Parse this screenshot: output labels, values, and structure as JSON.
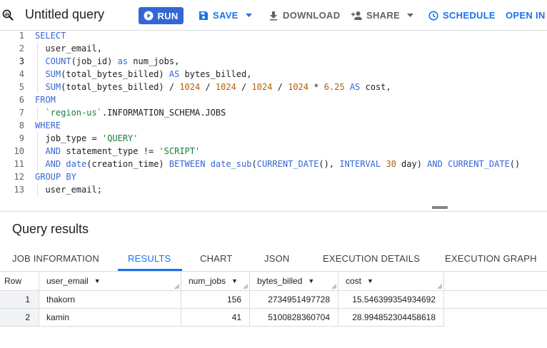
{
  "toolbar": {
    "title": "Untitled query",
    "run_label": "RUN",
    "save_label": "SAVE",
    "download_label": "DOWNLOAD",
    "share_label": "SHARE",
    "schedule_label": "SCHEDULE",
    "open_in_label": "OPEN IN",
    "icons": {
      "query": "query-magnifier-icon",
      "run": "play-circle-icon",
      "save": "save-disk-icon",
      "download": "download-icon",
      "share": "person-add-icon",
      "schedule": "clock-icon"
    }
  },
  "editor": {
    "active_line": 3,
    "lines": [
      {
        "num": "1",
        "tokens": [
          {
            "t": "SELECT",
            "c": "kw"
          }
        ]
      },
      {
        "num": "2",
        "tokens": [
          {
            "t": "  user_email,",
            "c": "plain"
          }
        ]
      },
      {
        "num": "3",
        "tokens": [
          {
            "t": "  ",
            "c": "plain"
          },
          {
            "t": "COUNT",
            "c": "kw"
          },
          {
            "t": "(job_id) ",
            "c": "plain"
          },
          {
            "t": "as",
            "c": "kw"
          },
          {
            "t": " num_jobs,",
            "c": "plain"
          }
        ]
      },
      {
        "num": "4",
        "tokens": [
          {
            "t": "  ",
            "c": "plain"
          },
          {
            "t": "SUM",
            "c": "kw"
          },
          {
            "t": "(total_bytes_billed) ",
            "c": "plain"
          },
          {
            "t": "AS",
            "c": "kw"
          },
          {
            "t": " bytes_billed,",
            "c": "plain"
          }
        ]
      },
      {
        "num": "5",
        "tokens": [
          {
            "t": "  ",
            "c": "plain"
          },
          {
            "t": "SUM",
            "c": "kw"
          },
          {
            "t": "(total_bytes_billed) / ",
            "c": "plain"
          },
          {
            "t": "1024",
            "c": "num"
          },
          {
            "t": " / ",
            "c": "plain"
          },
          {
            "t": "1024",
            "c": "num"
          },
          {
            "t": " / ",
            "c": "plain"
          },
          {
            "t": "1024",
            "c": "num"
          },
          {
            "t": " / ",
            "c": "plain"
          },
          {
            "t": "1024",
            "c": "num"
          },
          {
            "t": " * ",
            "c": "plain"
          },
          {
            "t": "6.25",
            "c": "num"
          },
          {
            "t": " ",
            "c": "plain"
          },
          {
            "t": "AS",
            "c": "kw"
          },
          {
            "t": " cost,",
            "c": "plain"
          }
        ]
      },
      {
        "num": "6",
        "tokens": [
          {
            "t": "FROM",
            "c": "kw"
          }
        ]
      },
      {
        "num": "7",
        "tokens": [
          {
            "t": "  ",
            "c": "plain"
          },
          {
            "t": "`region-us`",
            "c": "str"
          },
          {
            "t": ".INFORMATION_SCHEMA.JOBS",
            "c": "plain"
          }
        ]
      },
      {
        "num": "8",
        "tokens": [
          {
            "t": "WHERE",
            "c": "kw"
          }
        ]
      },
      {
        "num": "9",
        "tokens": [
          {
            "t": "  job_type = ",
            "c": "plain"
          },
          {
            "t": "'QUERY'",
            "c": "str"
          }
        ]
      },
      {
        "num": "10",
        "tokens": [
          {
            "t": "  ",
            "c": "plain"
          },
          {
            "t": "AND",
            "c": "kw"
          },
          {
            "t": " statement_type != ",
            "c": "plain"
          },
          {
            "t": "'SCRIPT'",
            "c": "str"
          }
        ]
      },
      {
        "num": "11",
        "tokens": [
          {
            "t": "  ",
            "c": "plain"
          },
          {
            "t": "AND",
            "c": "kw"
          },
          {
            "t": " ",
            "c": "plain"
          },
          {
            "t": "date",
            "c": "kw"
          },
          {
            "t": "(creation_time) ",
            "c": "plain"
          },
          {
            "t": "BETWEEN",
            "c": "kw"
          },
          {
            "t": " ",
            "c": "plain"
          },
          {
            "t": "date_sub",
            "c": "kw"
          },
          {
            "t": "(",
            "c": "plain"
          },
          {
            "t": "CURRENT_DATE",
            "c": "kw"
          },
          {
            "t": "(), ",
            "c": "plain"
          },
          {
            "t": "INTERVAL",
            "c": "kw"
          },
          {
            "t": " ",
            "c": "plain"
          },
          {
            "t": "30",
            "c": "num"
          },
          {
            "t": " day) ",
            "c": "plain"
          },
          {
            "t": "AND",
            "c": "kw"
          },
          {
            "t": " ",
            "c": "plain"
          },
          {
            "t": "CURRENT_DATE",
            "c": "kw"
          },
          {
            "t": "()",
            "c": "plain"
          }
        ]
      },
      {
        "num": "12",
        "tokens": [
          {
            "t": "GROUP BY",
            "c": "kw"
          }
        ]
      },
      {
        "num": "13",
        "tokens": [
          {
            "t": "  user_email;",
            "c": "plain"
          }
        ]
      }
    ]
  },
  "results": {
    "title": "Query results",
    "tabs": [
      {
        "label": "JOB INFORMATION",
        "active": false
      },
      {
        "label": "RESULTS",
        "active": true
      },
      {
        "label": "CHART",
        "active": false
      },
      {
        "label": "JSON",
        "active": false
      },
      {
        "label": "EXECUTION DETAILS",
        "active": false
      },
      {
        "label": "EXECUTION GRAPH",
        "active": false
      }
    ],
    "columns": [
      {
        "label": "Row",
        "sortable": false
      },
      {
        "label": "user_email",
        "sortable": true
      },
      {
        "label": "num_jobs",
        "sortable": true
      },
      {
        "label": "bytes_billed",
        "sortable": true
      },
      {
        "label": "cost",
        "sortable": true
      }
    ],
    "rows": [
      [
        "1",
        "thakorn",
        "156",
        "2734951497728",
        "15.546399354934692"
      ],
      [
        "2",
        "kamin",
        "41",
        "5100828360704",
        "28.994852304458618"
      ]
    ]
  },
  "colors": {
    "accent": "#1a73e8",
    "run_button": "#3367d6",
    "keyword": "#3367d6",
    "string": "#188038",
    "number": "#b06000"
  }
}
